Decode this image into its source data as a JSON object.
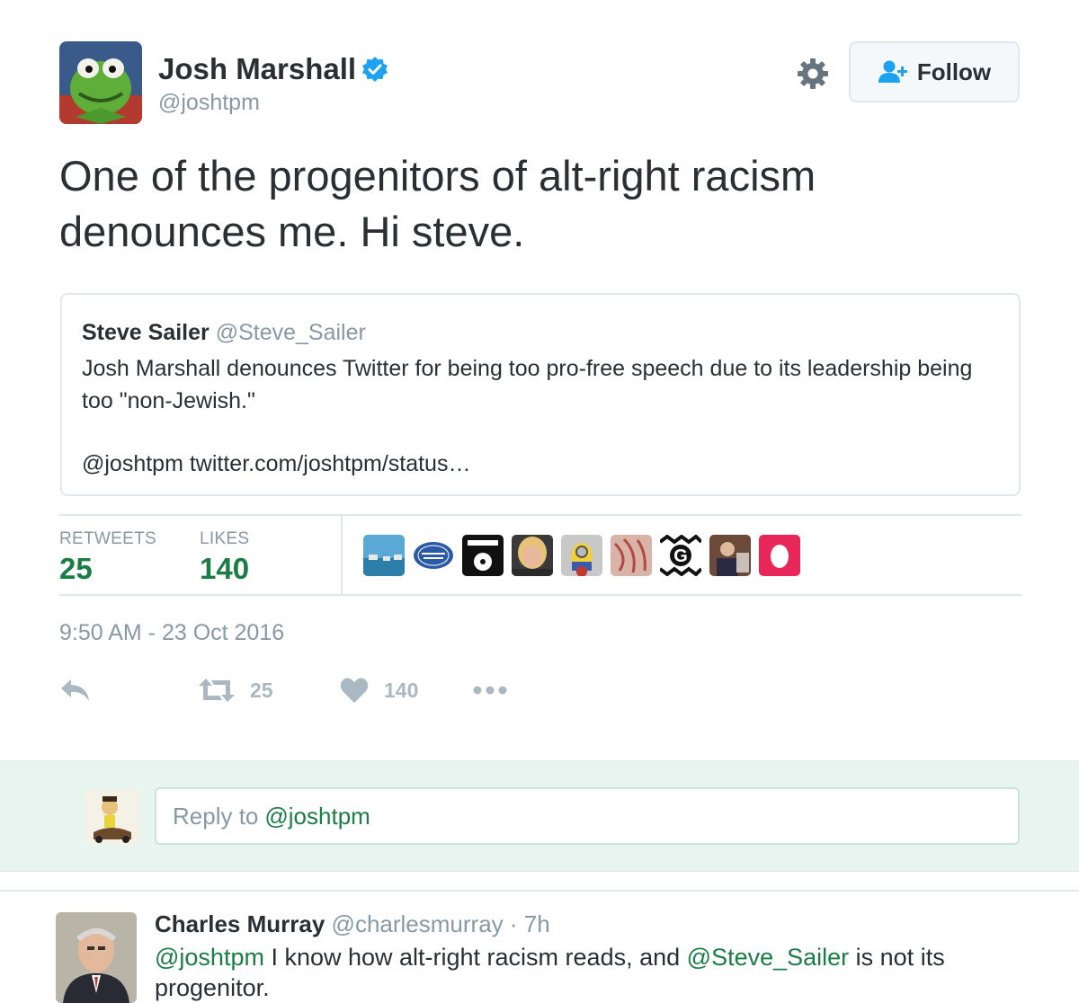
{
  "author": {
    "name": "Josh Marshall",
    "handle": "@joshtpm",
    "verified_icon": "verified-badge-icon"
  },
  "header": {
    "follow_label": "Follow",
    "settings_icon": "gear-icon"
  },
  "tweet": {
    "text_line1": "One of the progenitors of alt-right racism",
    "text_line2": "denounces me. Hi steve."
  },
  "quote": {
    "name": "Steve Sailer",
    "handle": "@Steve_Sailer",
    "body": "Josh Marshall denounces Twitter for being too pro-free speech due to its leadership being too \"non-Jewish.\"",
    "link": "@joshtpm twitter.com/joshtpm/status…"
  },
  "stats": {
    "retweets_label": "RETWEETS",
    "retweets_value": "25",
    "likes_label": "LIKES",
    "likes_value": "140"
  },
  "timestamp": "9:50 AM - 23 Oct 2016",
  "actions": {
    "retweet_count": "25",
    "like_count": "140"
  },
  "reply_box": {
    "placeholder_prefix": "Reply to",
    "mention": "@joshtpm"
  },
  "reply_tweet": {
    "name": "Charles Murray",
    "handle": "@charlesmurray",
    "separator": "·",
    "time": "7h",
    "mention1": "@joshtpm",
    "text_mid": " I know how alt-right racism reads, and ",
    "mention2": "@Steve_Sailer",
    "text_end": " is not its progenitor."
  },
  "colors": {
    "accent_green": "#1a7d45",
    "muted": "#8899a6",
    "verified_blue": "#1da1f2",
    "reply_band": "#e8f4ef"
  }
}
